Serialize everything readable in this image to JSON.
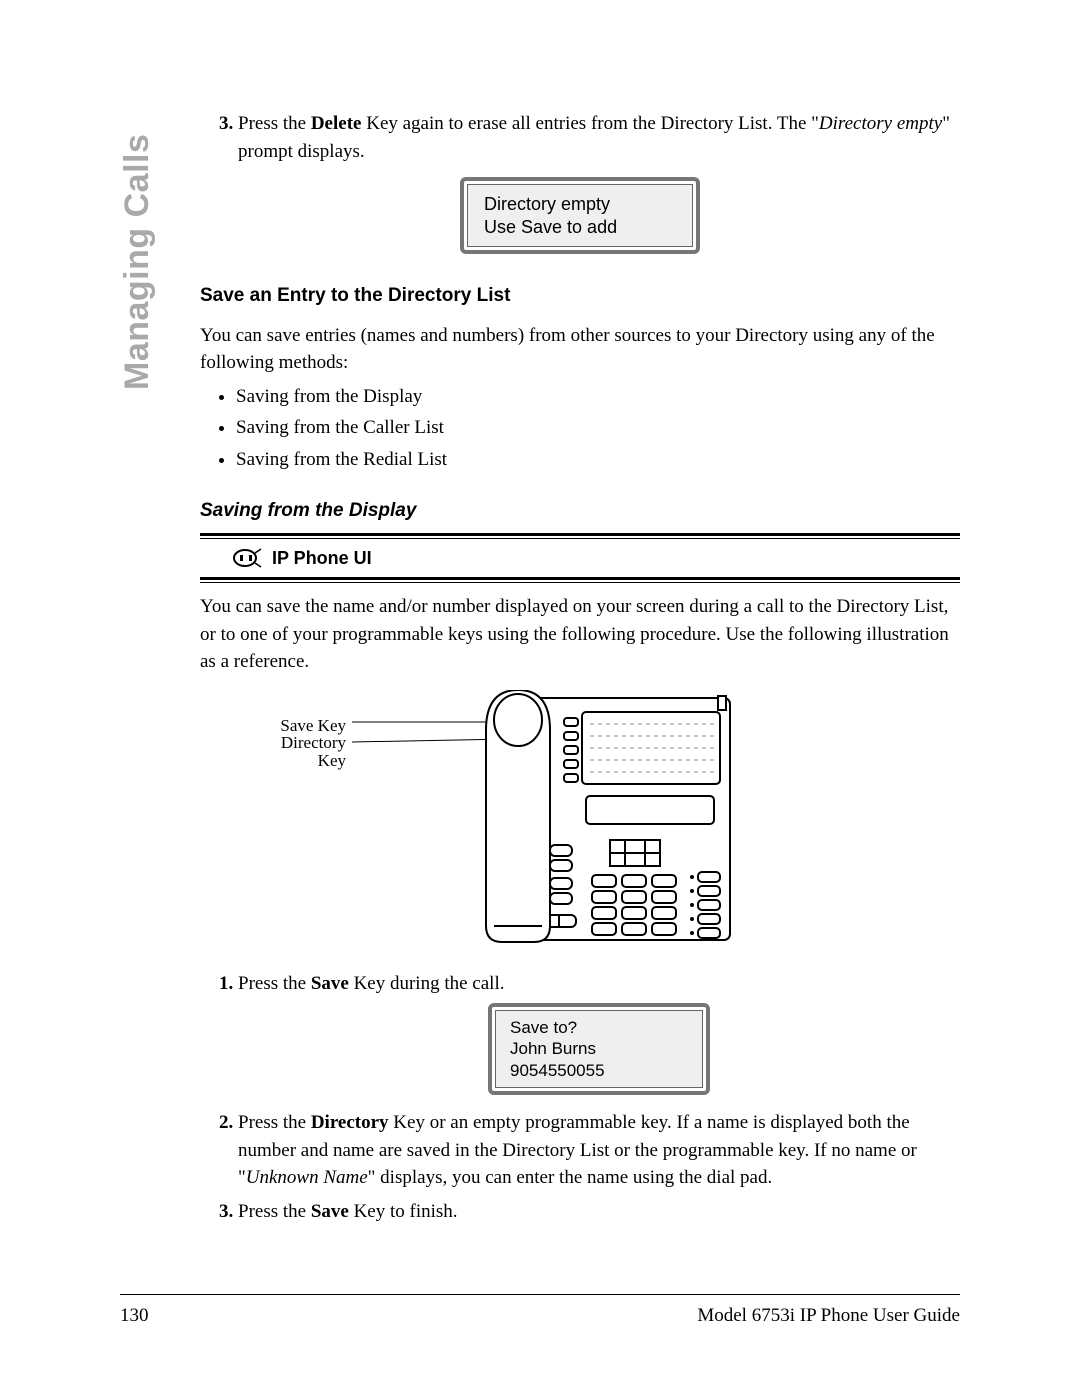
{
  "sidebar_tab": "Managing Calls",
  "step3": {
    "prefix": "Press the ",
    "bold1": "Delete",
    "mid": " Key again to erase all entries from the Directory List. The \"",
    "ital": "Directory empty",
    "suffix": "\" prompt displays."
  },
  "lcd1": {
    "line1": "Directory empty",
    "line2": "Use Save to add"
  },
  "heading_save_entry": "Save an Entry to the Directory List",
  "save_intro": "You can save entries (names and numbers) from other sources to your Directory using any of the following methods:",
  "methods": [
    "Saving from the Display",
    "Saving from the Caller List",
    "Saving from the Redial List"
  ],
  "heading_saving_display": "Saving from the Display",
  "ip_phone_ui": "IP Phone UI",
  "saving_display_para": "You can save the name and/or number displayed on your screen during a call to the Directory List, or to one of your programmable keys using the following procedure. Use the following illustration as a reference.",
  "phone_labels": {
    "save_key": "Save Key",
    "directory_key_l1": "Directory",
    "directory_key_l2": "Key"
  },
  "step1b": {
    "prefix": "Press the ",
    "bold": "Save",
    "suffix": " Key during the call."
  },
  "lcd2": {
    "line1": "Save to?",
    "line2": "John Burns",
    "line3": "9054550055"
  },
  "step2b": {
    "prefix": "Press the ",
    "bold": "Directory",
    "mid": " Key or an empty programmable key. If a name is displayed both the number and name are saved in the Directory List or the programmable key. If no name or \"",
    "ital": "Unknown Name",
    "suffix": "\" displays, you can enter the name using the dial pad."
  },
  "step3b": {
    "prefix": "Press the ",
    "bold": "Save",
    "suffix": " Key to finish."
  },
  "footer": {
    "page_number": "130",
    "doc_title": "Model 6753i IP Phone User Guide"
  }
}
